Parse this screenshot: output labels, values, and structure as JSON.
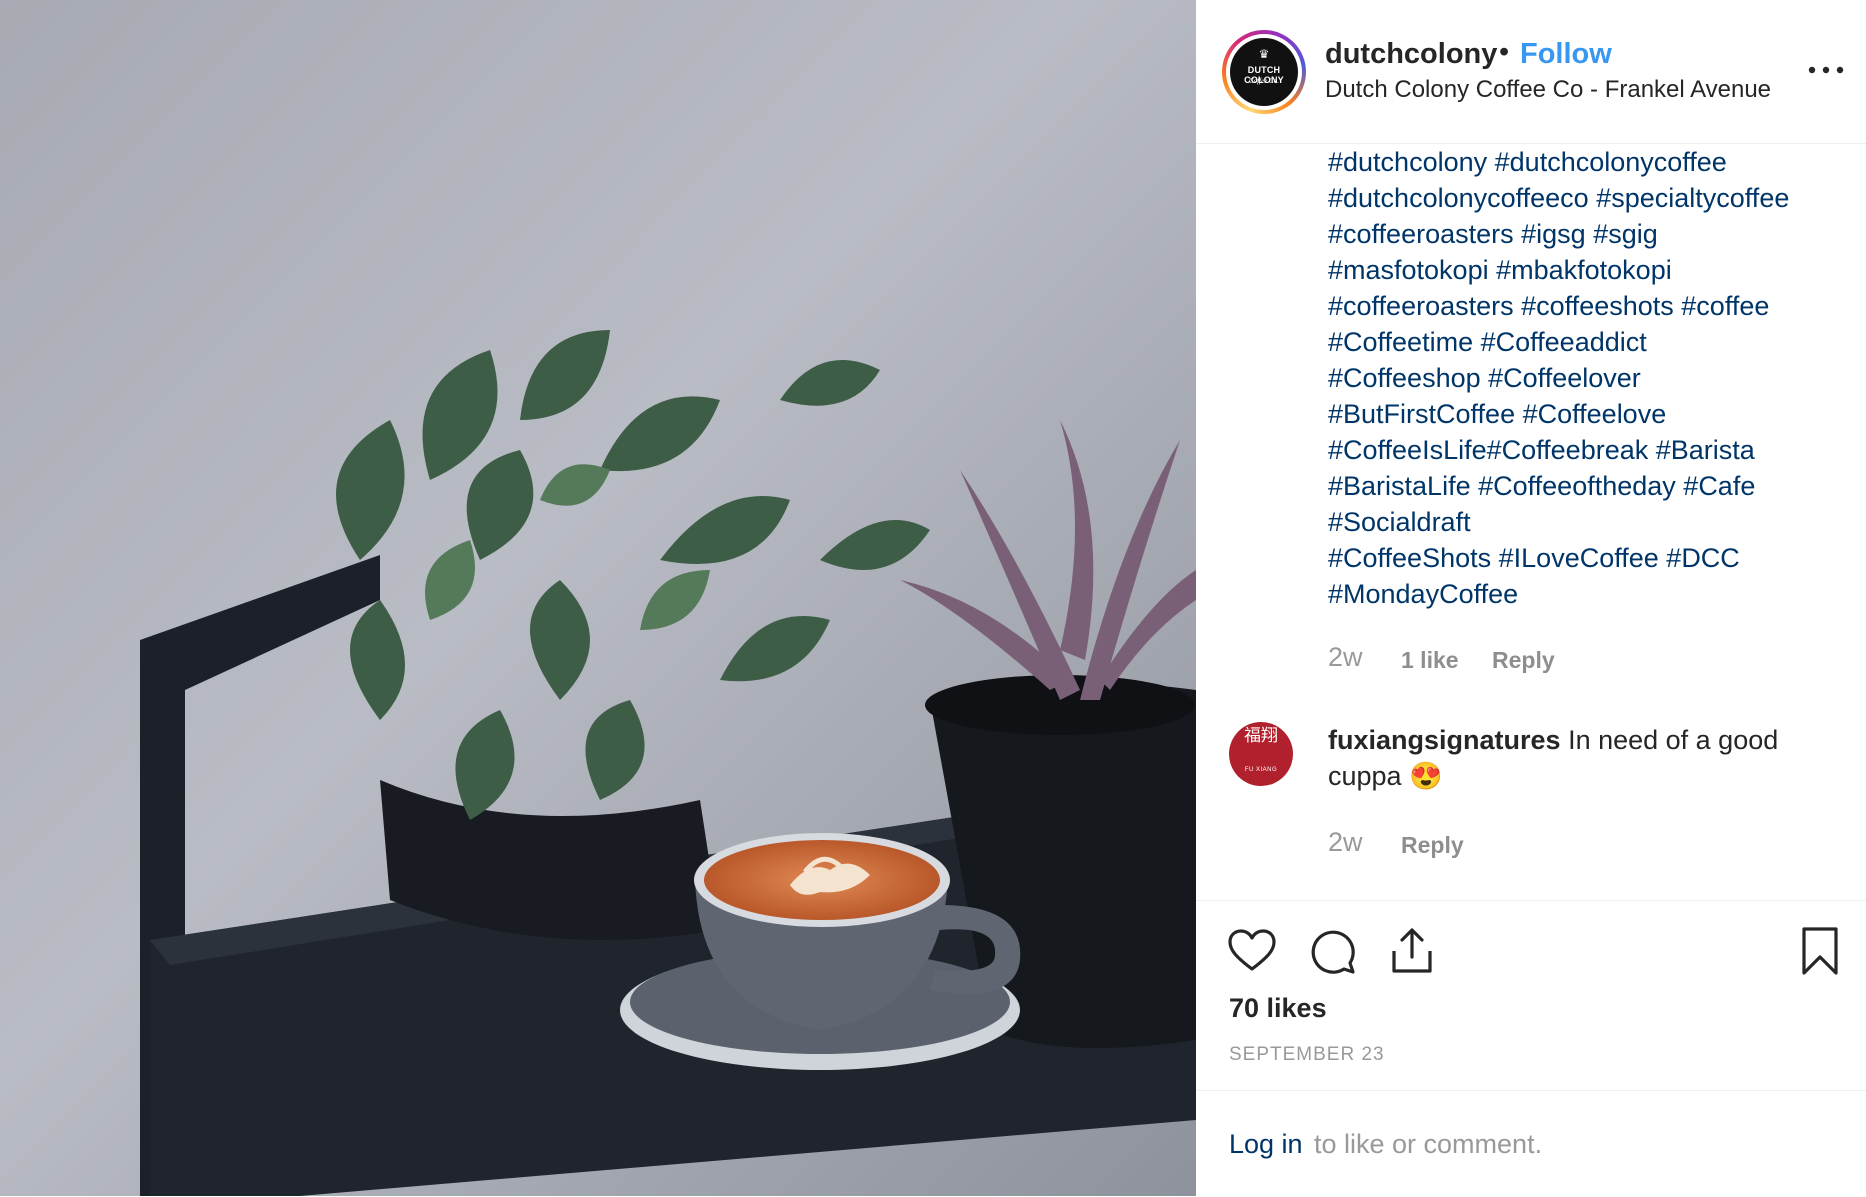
{
  "header": {
    "avatar_text_line1": "DUTCH COLONY",
    "avatar_text_line2": "Coffee Co.",
    "username": "dutchcolony",
    "separator": "•",
    "follow_label": "Follow",
    "location": "Dutch Colony Coffee Co - Frankel Avenue"
  },
  "caption": {
    "hashtag_lines": [
      [
        "#dutchcolony",
        "#dutchcolonycoffee"
      ],
      [
        "#dutchcolonycoffeeco",
        "#specialtycoffee"
      ],
      [
        "#coffeeroasters",
        "#igsg",
        "#sgig"
      ],
      [
        "#masfotokopi",
        "#mbakfotokopi"
      ],
      [
        "#coffeeroasters",
        "#coffeeshots",
        "#coffee"
      ],
      [
        "#Coffeetime",
        "#Coffeeaddict"
      ],
      [
        "#Coffeeshop",
        "#Coffeelover"
      ],
      [
        "#ButFirstCoffee",
        "#Coffeelove"
      ],
      [
        "#CoffeeIsLife#Coffeebreak",
        "#Barista"
      ],
      [
        "#BaristaLife",
        "#Coffeeoftheday",
        "#Cafe"
      ],
      [
        "#Socialdraft"
      ],
      [
        "#CoffeeShots",
        "#ILoveCoffee",
        "#DCC"
      ],
      [
        "#MondayCoffee"
      ]
    ],
    "time": "2w",
    "likes": "1 like",
    "reply": "Reply"
  },
  "comment": {
    "avatar_text": "福翔",
    "avatar_name": "FU XIANG",
    "username": "fuxiangsignatures",
    "text": "In need of a good cuppa 😍",
    "time": "2w",
    "reply": "Reply"
  },
  "actions": {
    "icons": [
      "heart-icon",
      "comment-icon",
      "share-icon",
      "bookmark-icon"
    ],
    "likes": "70 likes",
    "date": "SEPTEMBER 23"
  },
  "login": {
    "link": "Log in",
    "rest": "to like or comment."
  },
  "colors": {
    "link_blue": "#3897f0",
    "hashtag_navy": "#003569",
    "muted": "#8e8e8e"
  }
}
